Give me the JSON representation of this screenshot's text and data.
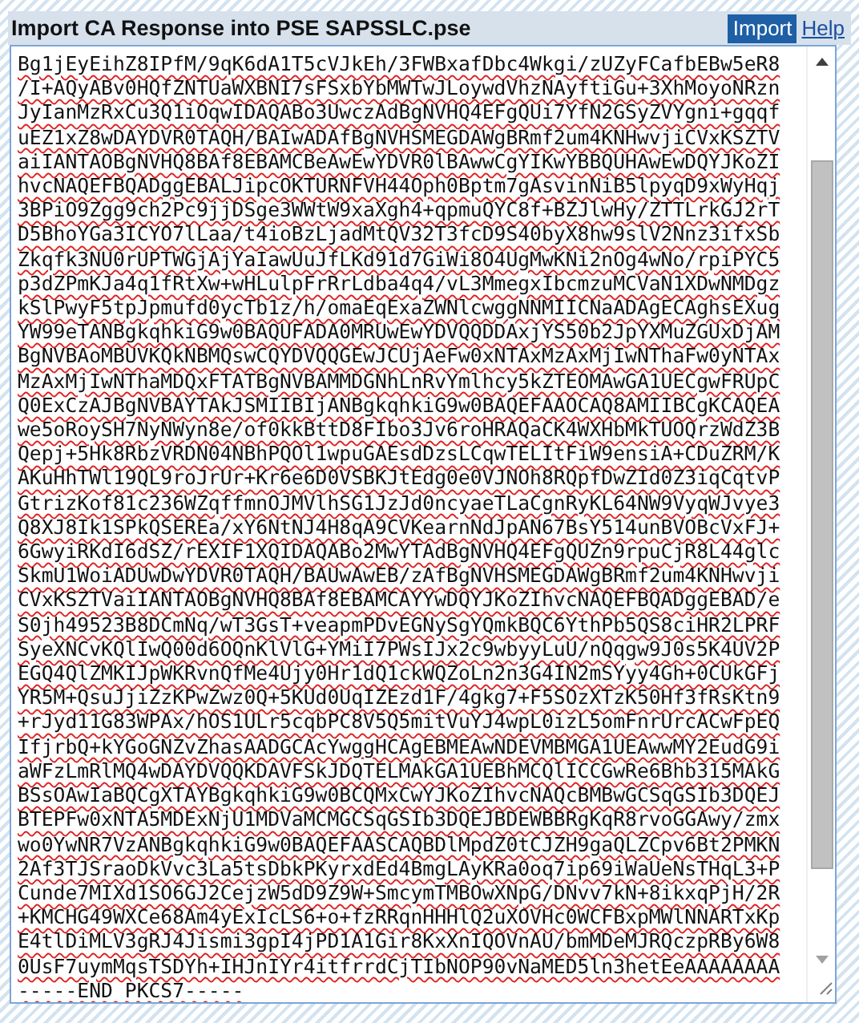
{
  "window": {
    "title": "Import CA Response into PSE SAPSSLC.pse"
  },
  "toolbar": {
    "buttons": [
      {
        "label": "Import",
        "kind": "primary"
      },
      {
        "label": "Help",
        "kind": "link"
      }
    ]
  },
  "response_field": {
    "value": "Bg1jEyEihZ8IPfM/9qK6dA1T5cVJkEh/3FWBxafDbc4Wkgi/zUZyFCafbEBw5eR8\n/I+AQyABv0HQfZNTUaWXBNI7sFSxbYbMWTwJLoywdVhzNAyftiGu+3XhMoyoNRzn\nJyIanMzRxCu3Q1iOqwIDAQABo3UwczAdBgNVHQ4EFgQUi7YfN2GSyZVYgni+gqqf\nuEZ1xZ8wDAYDVR0TAQH/BAIwADAfBgNVHSMEGDAWgBRmf2um4KNHwvjiCVxKSZTV\naiIANTAOBgNVHQ8BAf8EBAMCBeAwEwYDVR0lBAwwCgYIKwYBBQUHAwEwDQYJKoZI\nhvcNAQEFBQADggEBALJipcOKTURNFVH44Oph0Bptm7gAsvinNiB5lpyqD9xWyHqj\n3BPiO9Zgg9ch2Pc9jjDSge3WWtW9xaXgh4+qpmuQYC8f+BZJlwHy/ZTTLrkGJ2rT\nD5BhoYGa3ICYO7lLaa/t4ioBzLjadMtQV32T3fcD9S40byX8hw9slV2Nnz3ifxSb\nZkqfk3NU0rUPTWGjAjYaIawUuJfLKd91d7GiWi8O4UgMwKNi2nOg4wNo/rpiPYC5\np3dZPmKJa4q1fRtXw+wHLulpFrRrLdba4q4/vL3MmegxIbcmzuMCVaN1XDwNMDgz\nkSlPwyF5tpJpmufd0ycTb1z/h/omaEqExaZWNlcwggNNMIICNaADAgECAghsEXug\nYW99eTANBgkqhkiG9w0BAQUFADA0MRUwEwYDVQQDDAxjYS50b2JpYXMuZGUxDjAM\nBgNVBAoMBUVKQkNBMQswCQYDVQQGEwJCUjAeFw0xNTAxMzAxMjIwNThaFw0yNTAx\nMzAxMjIwNThaMDQxFTATBgNVBAMMDGNhLnRvYmlhcy5kZTEOMAwGA1UECgwFRUpC\nQ0ExCzAJBgNVBAYTAkJSMIIBIjANBgkqhkiG9w0BAQEFAAOCAQ8AMIIBCgKCAQEA\nwe5oRoySH7NyNWyn8e/of0kkBttD8FIbo3Jv6roHRAQaCK4WXHbMkTUOQrzWdZ3B\nQepj+5Hk8RbzVRDN04NBhPQOl1wpuGAEsdDzsLCqwTELItFiW9ensiA+CDuZRM/K\nAKuHhTWl19QL9roJrUr+Kr6e6D0VSBKJtEdg0e0VJNOh8RQpfDwZId0Z3iqCqtvP\nGtrizKof81c236WZqffmnOJMVlhSG1JzJd0ncyaeTLaCgnRyKL64NW9VyqWJvye3\nQ8XJ8Ik1SPkQSEREa/xY6NtNJ4H8qA9CVKearnNdJpAN67BsY514unBVOBcVxFJ+\n6GwyiRKdI6dSZ/rEXIF1XQIDAQABo2MwYTAdBgNVHQ4EFgQUZn9rpuCjR8L44glc\nSkmU1WoiADUwDwYDVR0TAQH/BAUwAwEB/zAfBgNVHSMEGDAWgBRmf2um4KNHwvji\nCVxKSZTVaiIANTAOBgNVHQ8BAf8EBAMCAYYwDQYJKoZIhvcNAQEFBQADggEBAD/e\nS0jh49523B8DCmNq/wT3GsT+veapmPDvEGNySgYQmkBQC6YthPb5QS8ciHR2LPRF\nSyeXNCvKQlIwQ00d6OQnKlVlG+YMiI7PWsIJx2c9wbyyLuU/nQqgw9J0s5K4UV2P\nEGQ4QlZMKIJpWKRvnQfMe4Ujy0Hr1dQ1ckWQZoLn2n3G4IN2mSYyy4Gh+0CUkGFj\nYR5M+QsuJjiZzKPwZwz0Q+5KUd0UqIZEzd1F/4gkg7+F5SOzXTzK50Hf3fRsKtn9\n+rJyd11G83WPAx/hOS1ULr5cqbPC8V5Q5mitVuYJ4wpL0izL5omFnrUrcACwFpEQ\nIfjrbQ+kYGoGNZvZhasAADGCAcYwggHCAgEBMEAwNDEVMBMGA1UEAwwMY2EudG9i\naWFzLmRlMQ4wDAYDVQQKDAVFSkJDQTELMAkGA1UEBhMCQlICCGwRe6Bhb315MAkG\nBSsOAwIaBQCgXTAYBgkqhkiG9w0BCQMxCwYJKoZIhvcNAQcBMBwGCSqGSIb3DQEJ\nBTEPFw0xNTA5MDExNjU1MDVaMCMGCSqGSIb3DQEJBDEWBBRgKqR8rvoGGAwy/zmx\nwo0YwNR7VzANBgkqhkiG9w0BAQEFAASCAQBDlMpdZ0tCJZH9gaQLZCpv6Bt2PMKN\n2Af3TJSraoDkVvc3La5tsDbkPKyrxdEd4BmgLAyKRa0oq7ip69iWaUeNsTHqL3+P\nCunde7MIXd1SO6GJ2CejzW5dD9Z9W+SmcymTMBOwXNpG/DNvv7kN+8ikxqPjH/2R\n+KMCHG49WXCe68Am4yExIcLS6+o+fzRRqnHHHlQ2uXOVHc0WCFBxpMWlNNARTxKp\nE4tlDiMLV3gRJ4Jismi3gpI4jPD1A1Gir8KxXnIQOVnAU/bmMDeMJRQczpRBy6W8\n0UsF7uymMqsTSDYh+IHJnIYr4itfrrdCjTIbNOP90vNaMED5ln3hetEeAAAAAAAA\n-----END PKCS7-----"
  }
}
